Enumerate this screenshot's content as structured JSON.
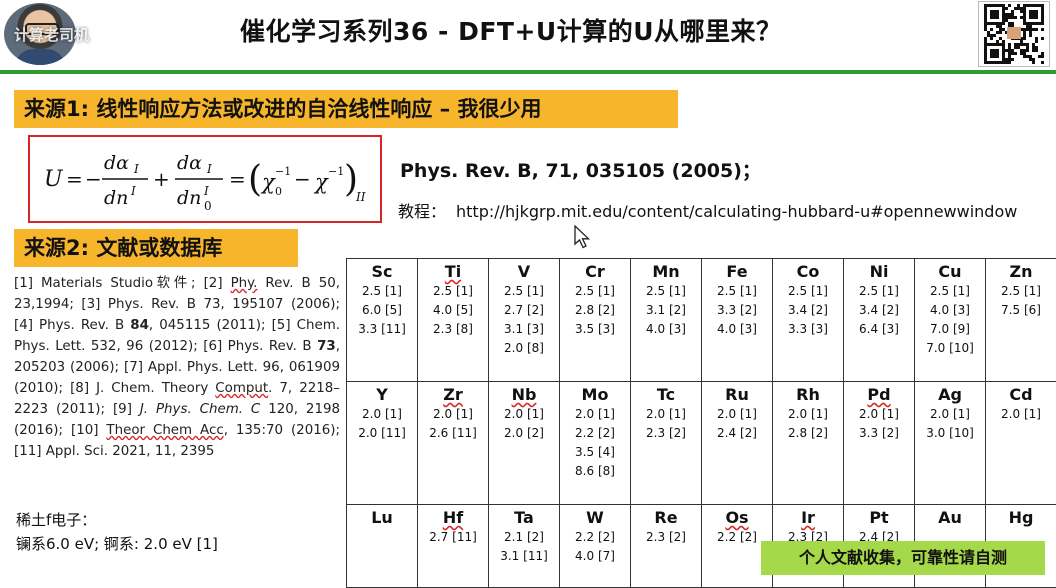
{
  "header": {
    "title": "催化学习系列36 - DFT+U计算的U从哪里来？",
    "watermark": "计算老司机"
  },
  "source1": {
    "heading": "来源1: 线性响应方法或改进的自洽线性响应 – 我很少用",
    "reference": "Phys. Rev. B, 71, 035105 (2005)；",
    "tutorial_label": "教程：",
    "tutorial_url": "http://hjkgrp.mit.edu/content/calculating-hubbard-u#opennewwindow"
  },
  "source2": {
    "heading": "来源2: 文献或数据库"
  },
  "references": [
    "[1] Materials Studio软件; [2] ",
    "Phy.",
    " Rev. B 50, 23,1994; [3] Phys. Rev. B 73, 195107 (2006); [4] Phys. Rev. B ",
    "84",
    ", 045115 (2011); [5] Chem. Phys. Lett. 532, 96 (2012); [6] Phys. Rev. B ",
    "73",
    ", 205203 (2006); [7] Appl. Phys. Lett. 96, 061909 (2010); [8] J. Chem. Theory ",
    "Comput",
    ". 7, 2218–2223 (2011); [9] ",
    "J. Phys. Chem. C",
    " 120, 2198 (2016); [10] ",
    "Theor Chem Acc",
    ", 135:70 (2016); [11] Appl. Sci. 2021, 11, 2395"
  ],
  "rare_earth": {
    "title": "稀土f电子：",
    "values": "镧系6.0 eV;  锕系: 2.0 eV [1]"
  },
  "elements": [
    [
      {
        "symbol": "Sc",
        "values": [
          "2.5 [1]",
          "6.0 [5]",
          "3.3 [11]"
        ]
      },
      {
        "symbol": "Ti",
        "values": [
          "2.5 [1]",
          "4.0 [5]",
          "2.3 [8]"
        ]
      },
      {
        "symbol": "V",
        "values": [
          "2.5 [1]",
          "2.7 [2]",
          "3.1 [3]",
          "2.0 [8]"
        ]
      },
      {
        "symbol": "Cr",
        "values": [
          "2.5 [1]",
          "2.8 [2]",
          "3.5 [3]"
        ]
      },
      {
        "symbol": "Mn",
        "values": [
          "2.5 [1]",
          "3.1 [2]",
          "4.0 [3]"
        ]
      },
      {
        "symbol": "Fe",
        "values": [
          "2.5 [1]",
          "3.3 [2]",
          "4.0 [3]"
        ]
      },
      {
        "symbol": "Co",
        "values": [
          "2.5 [1]",
          "3.4 [2]",
          "3.3 [3]"
        ]
      },
      {
        "symbol": "Ni",
        "values": [
          "2.5 [1]",
          "3.4 [2]",
          "6.4 [3]"
        ]
      },
      {
        "symbol": "Cu",
        "values": [
          "2.5 [1]",
          "4.0 [3]",
          "7.0 [9]",
          "7.0 [10]"
        ]
      },
      {
        "symbol": "Zn",
        "values": [
          "2.5 [1]",
          "7.5 [6]"
        ]
      }
    ],
    [
      {
        "symbol": "Y",
        "values": [
          "2.0 [1]",
          "2.0 [11]"
        ]
      },
      {
        "symbol": "Zr",
        "values": [
          "2.0 [1]",
          "2.6 [11]"
        ]
      },
      {
        "symbol": "Nb",
        "values": [
          "2.0 [1]",
          "2.0 [2]"
        ]
      },
      {
        "symbol": "Mo",
        "values": [
          "2.0 [1]",
          "2.2 [2]",
          "3.5 [4]",
          "8.6 [8]"
        ]
      },
      {
        "symbol": "Tc",
        "values": [
          "2.0 [1]",
          "2.3 [2]"
        ]
      },
      {
        "symbol": "Ru",
        "values": [
          "2.0 [1]",
          "2.4 [2]"
        ]
      },
      {
        "symbol": "Rh",
        "values": [
          "2.0 [1]",
          "2.8 [2]"
        ]
      },
      {
        "symbol": "Pd",
        "values": [
          "2.0 [1]",
          "3.3 [2]"
        ]
      },
      {
        "symbol": "Ag",
        "values": [
          "2.0 [1]",
          "3.0 [10]"
        ]
      },
      {
        "symbol": "Cd",
        "values": [
          "2.0 [1]"
        ]
      }
    ],
    [
      {
        "symbol": "Lu",
        "values": []
      },
      {
        "symbol": "Hf",
        "values": [
          "2.7 [11]"
        ]
      },
      {
        "symbol": "Ta",
        "values": [
          "2.1 [2]",
          "3.1 [11]"
        ]
      },
      {
        "symbol": "W",
        "values": [
          "2.2 [2]",
          "4.0 [7]"
        ]
      },
      {
        "symbol": "Re",
        "values": [
          "2.3 [2]"
        ]
      },
      {
        "symbol": "Os",
        "values": [
          "2.2 [2]"
        ]
      },
      {
        "symbol": "Ir",
        "values": [
          "2.3 [2]"
        ]
      },
      {
        "symbol": "Pt",
        "values": [
          "2.4 [2]"
        ]
      },
      {
        "symbol": "Au",
        "values": []
      },
      {
        "symbol": "Hg",
        "values": []
      }
    ]
  ],
  "wavy_symbols": [
    "Ti",
    "Zr",
    "Nb",
    "Pd",
    "Hf",
    "Os",
    "Ir"
  ],
  "note": "个人文献收集，可靠性请自测",
  "colors": {
    "banner": "#f7b52c",
    "formula_border": "#d62728",
    "header_rule": "#2f9a2f",
    "note_bg": "#a6d94a"
  }
}
